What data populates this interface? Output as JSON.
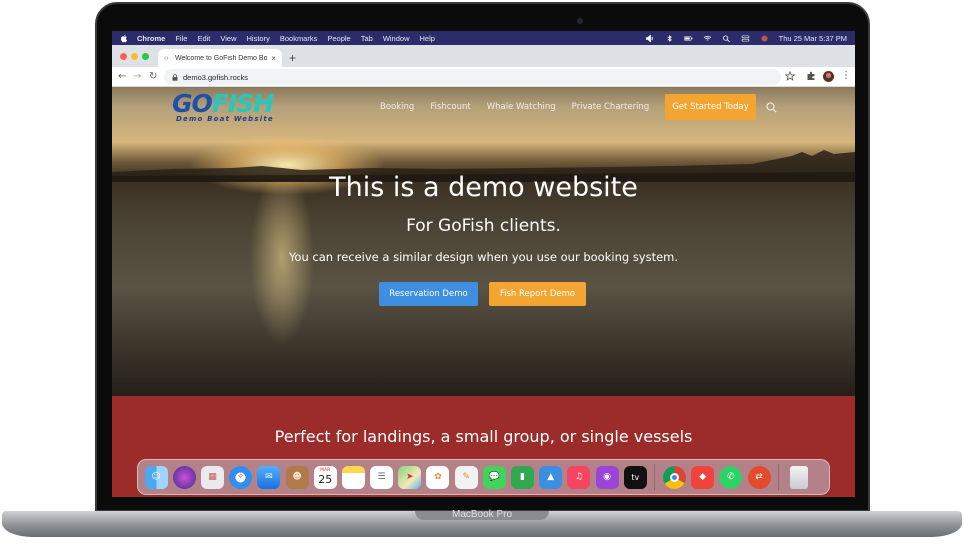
{
  "macbook_label": "MacBook Pro",
  "menubar": {
    "app": "Chrome",
    "items": [
      "File",
      "Edit",
      "View",
      "History",
      "Bookmarks",
      "People",
      "Tab",
      "Window",
      "Help"
    ],
    "datetime": "Thu 25 Mar  5:37 PM"
  },
  "browser": {
    "tab_title": "Welcome to GoFish Demo Boat",
    "new_tab": "+",
    "close": "×",
    "back": "←",
    "forward": "→",
    "reload": "↻",
    "url": "demo3.gofish.rocks",
    "menu": "⋮"
  },
  "site": {
    "logo_go": "GO",
    "logo_fish": "FISH",
    "logo_tagline": "Demo Boat Website",
    "nav": {
      "booking": "Booking",
      "fishcount": "Fishcount",
      "whale": "Whale Watching",
      "charter": "Private Chartering",
      "cta": "Get Started Today"
    },
    "hero_title": "This is a demo website",
    "hero_subtitle": "For GoFish clients.",
    "hero_text": "You can receive a similar design when you use our booking system.",
    "btn_reservation": "Reservation Demo",
    "btn_fish_report": "Fish Report Demo",
    "band_text": "Perfect for landings, a small group, or single vessels",
    "colors": {
      "cta_orange": "#f4a531",
      "button_blue": "#3e8ee2",
      "band_red": "#9b2c29"
    }
  },
  "dock": {
    "calendar_month": "MAR",
    "calendar_day": "25",
    "tv_label": "tv",
    "apps": [
      "finder-icon",
      "siri-icon",
      "launchpad-icon",
      "safari-icon",
      "mail-icon",
      "contacts-icon",
      "calendar-icon",
      "notes-icon",
      "reminders-icon",
      "maps-icon",
      "photos-icon",
      "textedit-icon",
      "messages-icon",
      "numbers-icon",
      "keynote-icon",
      "music-icon",
      "podcasts-icon",
      "appletv-icon",
      "chrome-icon",
      "anydesk-icon",
      "whatsapp-icon",
      "remote-desktop-icon",
      "trash-icon"
    ]
  }
}
